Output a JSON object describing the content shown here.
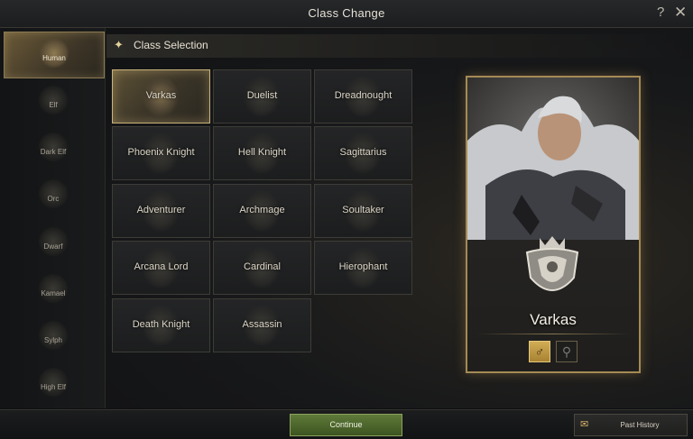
{
  "window": {
    "title": "Class Change",
    "help_label": "?",
    "close_label": "✕"
  },
  "races": [
    {
      "label": "Human",
      "active": true
    },
    {
      "label": "Elf"
    },
    {
      "label": "Dark Elf"
    },
    {
      "label": "Orc"
    },
    {
      "label": "Dwarf"
    },
    {
      "label": "Kamael"
    },
    {
      "label": "Sylph"
    },
    {
      "label": "High Elf"
    }
  ],
  "section": {
    "star": "✦",
    "title": "Class Selection"
  },
  "classes": [
    {
      "label": "Varkas",
      "selected": true
    },
    {
      "label": "Duelist"
    },
    {
      "label": "Dreadnought"
    },
    {
      "label": "Phoenix Knight"
    },
    {
      "label": "Hell Knight"
    },
    {
      "label": "Sagittarius"
    },
    {
      "label": "Adventurer"
    },
    {
      "label": "Archmage"
    },
    {
      "label": "Soultaker"
    },
    {
      "label": "Arcana Lord"
    },
    {
      "label": "Cardinal"
    },
    {
      "label": "Hierophant"
    },
    {
      "label": "Death Knight"
    },
    {
      "label": "Assassin"
    }
  ],
  "portrait": {
    "name": "Varkas",
    "male_icon": "♂",
    "female_icon": "⚲"
  },
  "footer": {
    "continue_label": "Continue",
    "history_label": "Past History",
    "history_icon": "✉"
  },
  "colors": {
    "accent_gold": "#c9b27a",
    "continue_green": "#5f7a3a"
  }
}
